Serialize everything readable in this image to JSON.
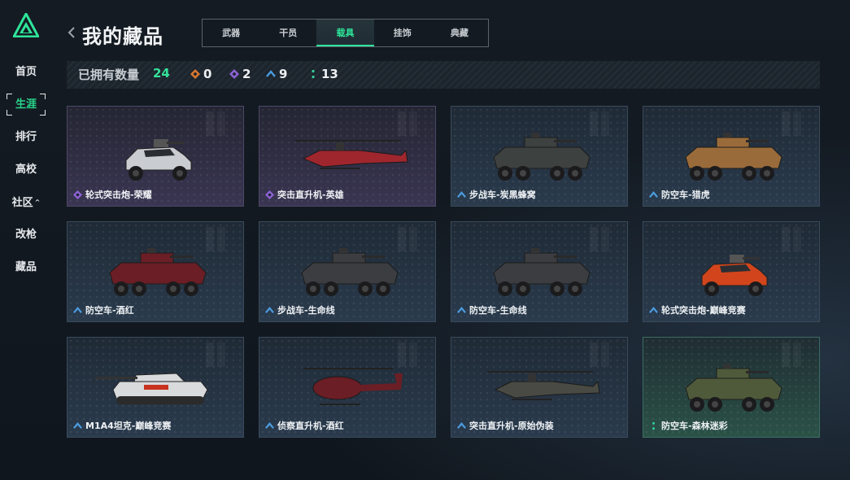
{
  "page": {
    "title": "我的藏品"
  },
  "sidebar": {
    "items": [
      {
        "label": "首页",
        "name": "sidebar-item-home",
        "active": false
      },
      {
        "label": "生涯",
        "name": "sidebar-item-career",
        "active": true
      },
      {
        "label": "排行",
        "name": "sidebar-item-ranking",
        "active": false
      },
      {
        "label": "高校",
        "name": "sidebar-item-university",
        "active": false
      },
      {
        "label": "社区",
        "name": "sidebar-item-community",
        "active": false,
        "caret": "^"
      },
      {
        "label": "改枪",
        "name": "sidebar-item-gun-mod",
        "active": false
      },
      {
        "label": "藏品",
        "name": "sidebar-item-collection",
        "active": false
      }
    ]
  },
  "tabs": [
    {
      "label": "武器",
      "active": false
    },
    {
      "label": "干员",
      "active": false
    },
    {
      "label": "载具",
      "active": true
    },
    {
      "label": "挂饰",
      "active": false
    },
    {
      "label": "典藏",
      "active": false
    }
  ],
  "stats": {
    "owned_label": "已拥有数量",
    "owned_count": "24",
    "rarities": [
      {
        "icon": "orange-diamond-icon",
        "color": "#d9772e",
        "count": "0"
      },
      {
        "icon": "purple-diamond-icon",
        "color": "#8d63d6",
        "count": "2"
      },
      {
        "icon": "blue-chevron-icon",
        "color": "#4a9bde",
        "count": "9"
      },
      {
        "icon": "green-dots-icon",
        "color": "#34d29a",
        "count": "13"
      }
    ]
  },
  "colors": {
    "accent": "#2ee59a",
    "purple": "#8d63d6",
    "blue": "#4a9bde",
    "green": "#34d29a"
  },
  "items": [
    {
      "name": "轮式突击炮-荣耀",
      "rarity": "purple",
      "vehicle": "buggy",
      "paint": "#c9ccd0"
    },
    {
      "name": "突击直升机-英雄",
      "rarity": "purple",
      "vehicle": "attack-heli",
      "paint": "#a0262e"
    },
    {
      "name": "步战车-炭黑蜂窝",
      "rarity": "blue",
      "vehicle": "apc-turret",
      "paint": "#3d4140"
    },
    {
      "name": "防空车-猎虎",
      "rarity": "blue",
      "vehicle": "apc-turret",
      "paint": "#9a6b3a"
    },
    {
      "name": "防空车-酒红",
      "rarity": "blue",
      "vehicle": "apc-aa",
      "paint": "#6b1e25"
    },
    {
      "name": "步战车-生命线",
      "rarity": "blue",
      "vehicle": "apc-8",
      "paint": "#3b3d40"
    },
    {
      "name": "防空车-生命线",
      "rarity": "blue",
      "vehicle": "apc-8",
      "paint": "#3b3d40"
    },
    {
      "name": "轮式突击炮-巅峰竞赛",
      "rarity": "blue",
      "vehicle": "buggy",
      "paint": "#d2451c"
    },
    {
      "name": "M1A4坦克-巅峰竞赛",
      "rarity": "blue",
      "vehicle": "tank",
      "paint": "#d8dadc"
    },
    {
      "name": "侦察直升机-酒红",
      "rarity": "blue",
      "vehicle": "scout-heli",
      "paint": "#6b1e25"
    },
    {
      "name": "突击直升机-原始伪装",
      "rarity": "blue",
      "vehicle": "attack-heli",
      "paint": "#4a4a44"
    },
    {
      "name": "防空车-森林迷彩",
      "rarity": "green",
      "vehicle": "apc-turret",
      "paint": "#4f5a3a"
    }
  ]
}
